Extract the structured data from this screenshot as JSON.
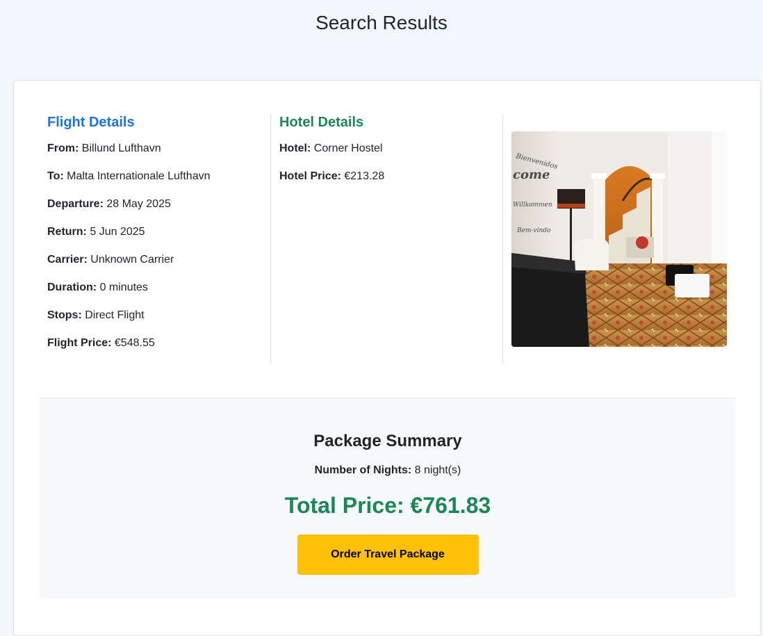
{
  "page": {
    "title": "Search Results"
  },
  "flight": {
    "heading": "Flight Details",
    "rows": [
      {
        "label": "From:",
        "value": "Billund Lufthavn"
      },
      {
        "label": "To:",
        "value": "Malta Internationale Lufthavn"
      },
      {
        "label": "Departure:",
        "value": "28 May 2025"
      },
      {
        "label": "Return:",
        "value": "5 Jun 2025"
      },
      {
        "label": "Carrier:",
        "value": "Unknown Carrier"
      },
      {
        "label": "Duration:",
        "value": "0 minutes"
      },
      {
        "label": "Stops:",
        "value": "Direct Flight"
      },
      {
        "label": "Flight Price:",
        "value": "€548.55"
      }
    ]
  },
  "hotel": {
    "heading": "Hotel Details",
    "rows": [
      {
        "label": "Hotel:",
        "value": "Corner Hostel"
      },
      {
        "label": "Hotel Price:",
        "value": "€213.28"
      }
    ],
    "image_icon": "hotel-lobby-photo"
  },
  "summary": {
    "title": "Package Summary",
    "nights_label": "Number of Nights:",
    "nights_value": "8 night(s)",
    "total_price": "Total Price: €761.83",
    "order_button_label": "Order Travel Package"
  },
  "colors": {
    "flight_heading": "#1a73e8",
    "hotel_heading": "#1b8754",
    "total_price": "#1b8754",
    "order_button": "#ffc107",
    "page_background": "#f2f7fc"
  }
}
